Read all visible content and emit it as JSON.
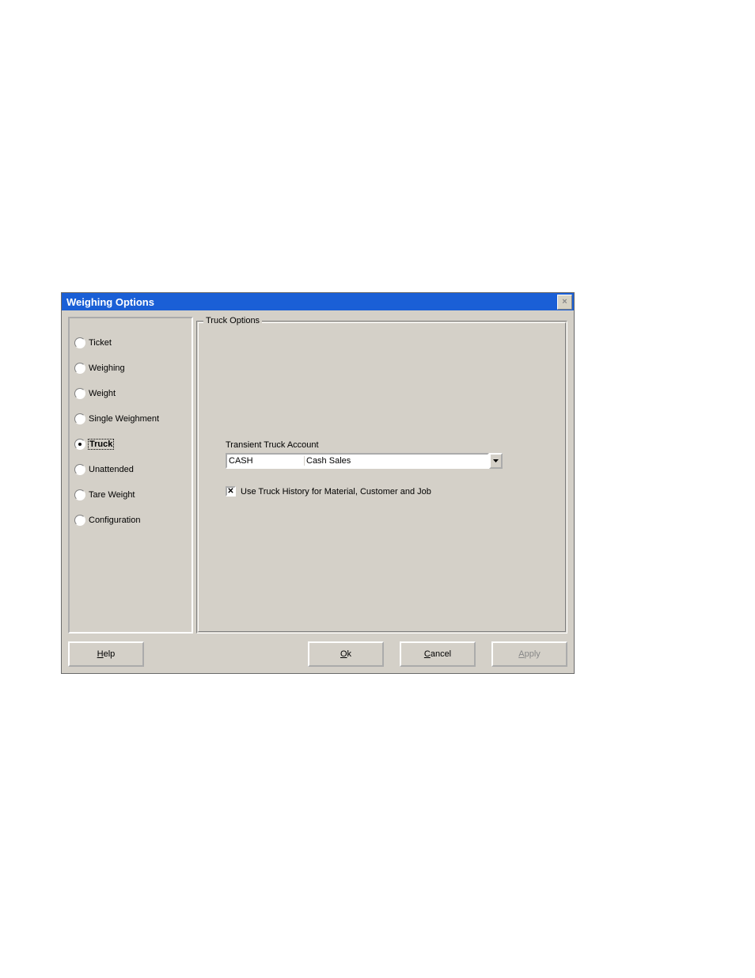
{
  "title": "Weighing Options",
  "side_options": [
    {
      "label": "Ticket",
      "checked": false
    },
    {
      "label": "Weighing",
      "checked": false
    },
    {
      "label": "Weight",
      "checked": false
    },
    {
      "label": "Single Weighment",
      "checked": false
    },
    {
      "label": "Truck",
      "checked": true
    },
    {
      "label": "Unattended",
      "checked": false
    },
    {
      "label": "Tare Weight",
      "checked": false
    },
    {
      "label": "Configuration",
      "checked": false
    }
  ],
  "group_title": "Truck Options",
  "transient_label": "Transient Truck Account",
  "combo": {
    "code": "CASH",
    "desc": "Cash   Sales"
  },
  "checkbox_label": "Use Truck History for Material, Customer and Job",
  "checkbox_checked": true,
  "buttons": {
    "help": "Help",
    "help_u": "H",
    "ok": "Ok",
    "ok_u": "O",
    "cancel": "Cancel",
    "cancel_u": "C",
    "apply": "Apply",
    "apply_u": "A"
  }
}
